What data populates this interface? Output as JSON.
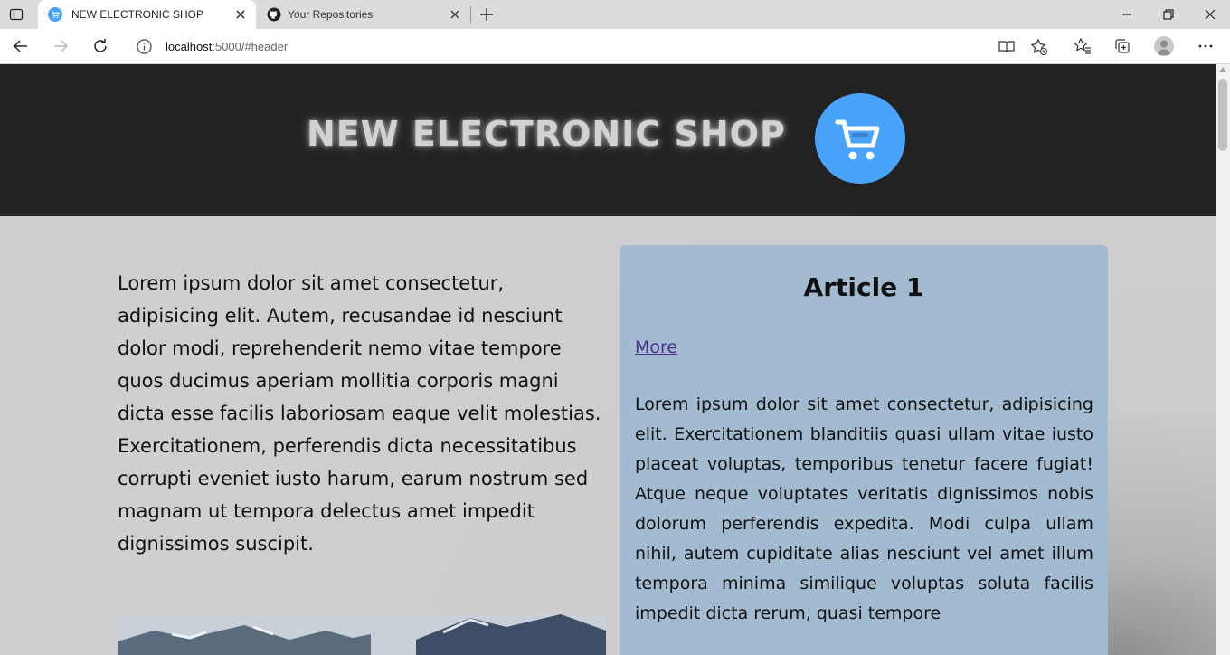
{
  "browser": {
    "tabs": [
      {
        "title": "NEW ELECTRONIC SHOP",
        "active": true,
        "icon": "shop-favicon"
      },
      {
        "title": "Your Repositories",
        "active": false,
        "icon": "github-icon"
      }
    ],
    "address": {
      "host": "localhost",
      "path": ":5000/#header"
    }
  },
  "page": {
    "header": {
      "title": "NEW ELECTRONIC SHOP",
      "logo_icon": "shopping-cart-icon",
      "logo_color": "#4aa3fa"
    },
    "intro_text": "Lorem ipsum dolor sit amet consectetur, adipisicing elit. Autem, recusandae id nesciunt dolor modi, reprehenderit nemo vitae tempore quos ducimus aperiam mollitia corporis magni dicta esse facilis laboriosam eaque velit molestias. Exercitationem, perferendis dicta necessitatibus corrupti eveniet iusto harum, earum nostrum sed magnam ut tempora delectus amet impedit dignissimos suscipit.",
    "article": {
      "title": "Article 1",
      "more_link": "More",
      "body": "Lorem ipsum dolor sit amet consectetur, adipisicing elit. Exercitationem blanditiis quasi ullam vitae iusto placeat voluptas, temporibus tenetur facere fugiat! Atque neque voluptates veritatis dignissimos nobis dolorum perferendis expedita. Modi culpa ullam nihil, autem cupiditate alias nesciunt vel amet illum tempora minima similique voluptas soluta facilis impedit dicta rerum, quasi tempore"
    }
  },
  "colors": {
    "header_bg": "#222222",
    "article_bg": "#a2bbd1",
    "page_bg": "#cfcfcf"
  }
}
